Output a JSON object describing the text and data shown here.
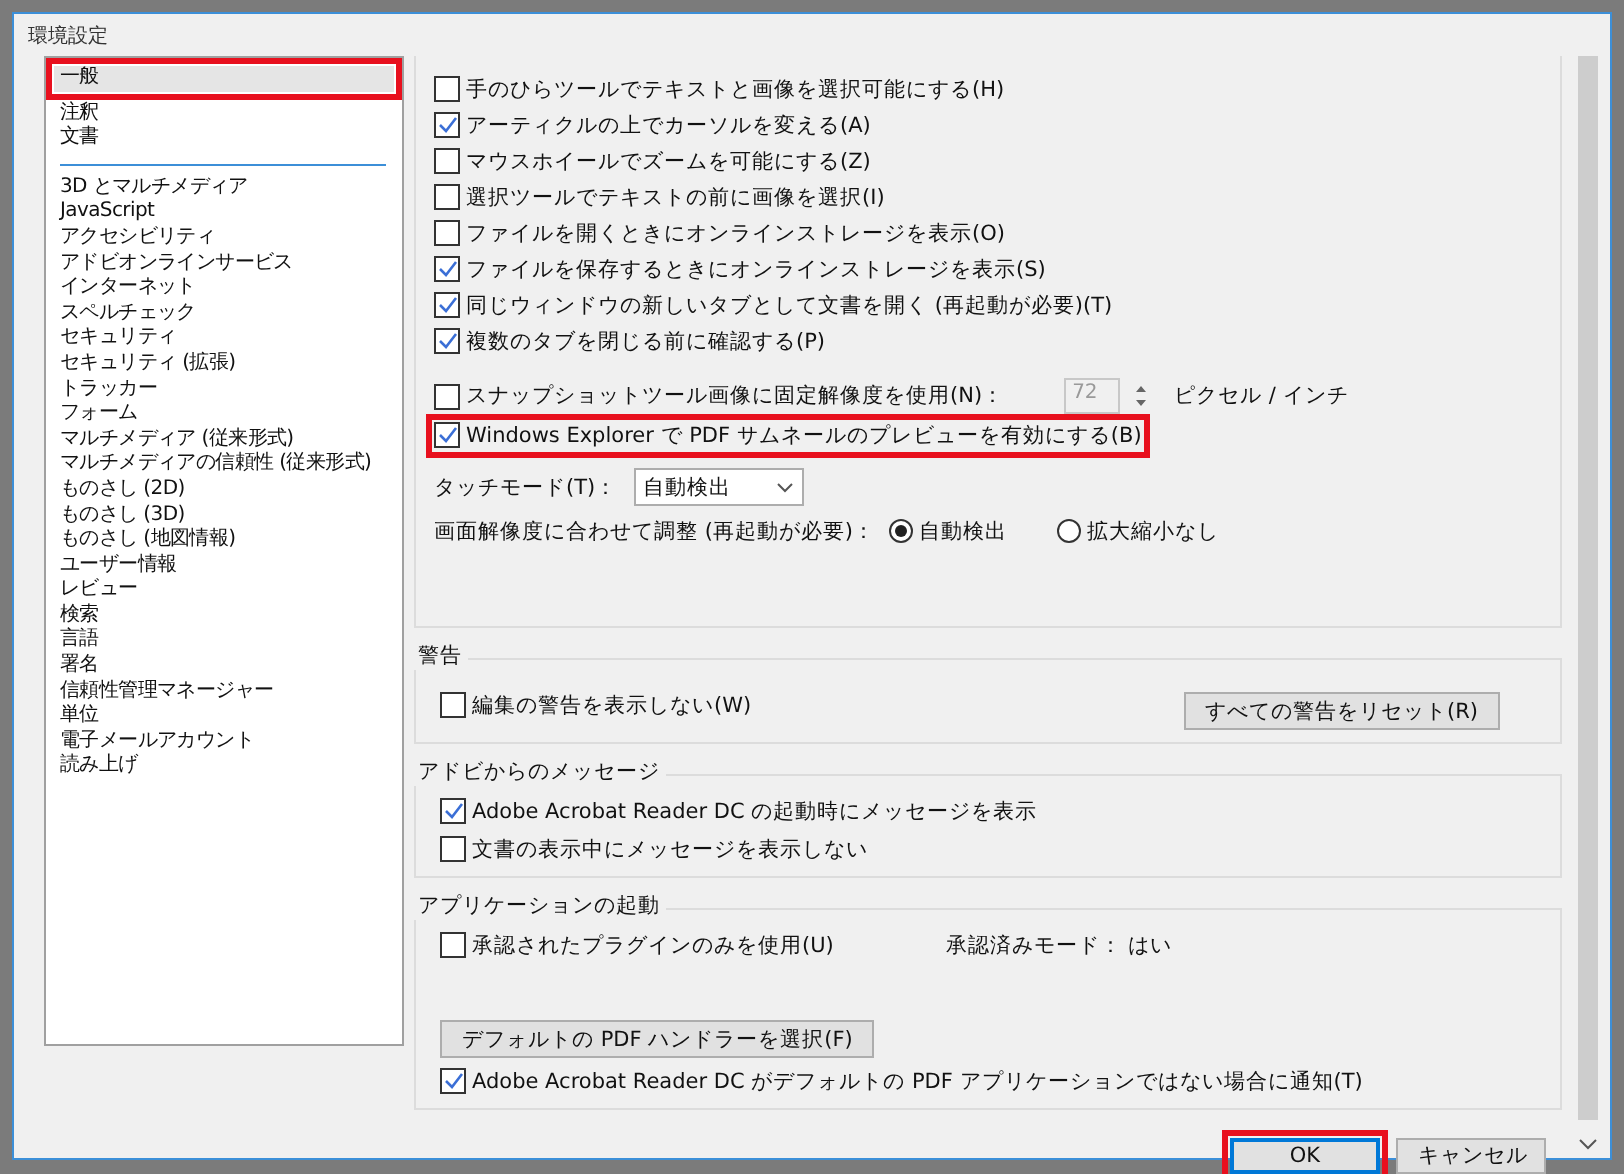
{
  "window": {
    "title": "環境設定"
  },
  "top_categories": [
    {
      "label": "一般",
      "selected": true,
      "highlighted": true
    },
    {
      "label": "注釈",
      "selected": false,
      "highlighted": false
    },
    {
      "label": "文書",
      "selected": false,
      "highlighted": false
    }
  ],
  "categories": [
    {
      "label": "3D とマルチメディア",
      "selected": false
    },
    {
      "label": "JavaScript",
      "selected": false
    },
    {
      "label": "アクセシビリティ",
      "selected": false
    },
    {
      "label": "アドビオンラインサービス",
      "selected": false
    },
    {
      "label": "インターネット",
      "selected": false
    },
    {
      "label": "スペルチェック",
      "selected": false
    },
    {
      "label": "セキュリティ",
      "selected": false
    },
    {
      "label": "セキュリティ (拡張)",
      "selected": false
    },
    {
      "label": "トラッカー",
      "selected": false
    },
    {
      "label": "フォーム",
      "selected": false
    },
    {
      "label": "マルチメディア (従来形式)",
      "selected": false
    },
    {
      "label": "マルチメディアの信頼性 (従来形式)",
      "selected": false
    },
    {
      "label": "ものさし (2D)",
      "selected": false
    },
    {
      "label": "ものさし (3D)",
      "selected": false
    },
    {
      "label": "ものさし (地図情報)",
      "selected": false
    },
    {
      "label": "ユーザー情報",
      "selected": false
    },
    {
      "label": "レビュー",
      "selected": false
    },
    {
      "label": "検索",
      "selected": false
    },
    {
      "label": "言語",
      "selected": false
    },
    {
      "label": "署名",
      "selected": false
    },
    {
      "label": "信頼性管理マネージャー",
      "selected": false
    },
    {
      "label": "単位",
      "selected": false
    },
    {
      "label": "電子メールアカウント",
      "selected": false
    },
    {
      "label": "読み上げ",
      "selected": false
    }
  ],
  "general_options": [
    {
      "kind": "checkbox",
      "label": "手のひらツールでテキストと画像を選択可能にする(H)",
      "checked": false,
      "highlighted": false
    },
    {
      "kind": "checkbox",
      "label": "アーティクルの上でカーソルを変える(A)",
      "checked": true,
      "highlighted": false
    },
    {
      "kind": "checkbox",
      "label": "マウスホイールでズームを可能にする(Z)",
      "checked": false,
      "highlighted": false
    },
    {
      "kind": "checkbox",
      "label": "選択ツールでテキストの前に画像を選択(I)",
      "checked": false,
      "highlighted": false
    },
    {
      "kind": "checkbox",
      "label": "ファイルを開くときにオンラインストレージを表示(O)",
      "checked": false,
      "highlighted": false
    },
    {
      "kind": "checkbox",
      "label": "ファイルを保存するときにオンラインストレージを表示(S)",
      "checked": true,
      "highlighted": false
    },
    {
      "kind": "checkbox",
      "label": "同じウィンドウの新しいタブとして文書を開く (再起動が必要)(T)",
      "checked": true,
      "highlighted": false
    },
    {
      "kind": "checkbox",
      "label": "複数のタブを閉じる前に確認する(P)",
      "checked": true,
      "highlighted": false
    },
    {
      "kind": "spin",
      "label": "スナップショットツール画像に固定解像度を使用(N)：",
      "checked": false,
      "value": "72",
      "unit": "ピクセル / インチ",
      "disabled": true
    },
    {
      "kind": "checkbox",
      "label": "Windows Explorer で PDF サムネールのプレビューを有効にする(B)",
      "checked": true,
      "highlighted": true
    },
    {
      "kind": "select",
      "label": "タッチモード(T)：",
      "value": "自動検出"
    },
    {
      "kind": "radio",
      "label": "画面解像度に合わせて調整 (再起動が必要)：",
      "choices": [
        {
          "label": "自動検出",
          "selected": true
        },
        {
          "label": "拡大縮小なし",
          "selected": false
        }
      ]
    }
  ],
  "sections": [
    {
      "title": "警告",
      "rows": [
        [
          {
            "kind": "checkbox",
            "label": "編集の警告を表示しない(W)",
            "checked": false
          },
          {
            "kind": "button",
            "label": "すべての警告をリセット(R)"
          }
        ]
      ]
    },
    {
      "title": "アドビからのメッセージ",
      "rows": [
        [
          {
            "kind": "checkbox",
            "label": "Adobe Acrobat Reader DC の起動時にメッセージを表示",
            "checked": true
          }
        ],
        [
          {
            "kind": "checkbox",
            "label": "文書の表示中にメッセージを表示しない",
            "checked": false
          }
        ]
      ]
    },
    {
      "title": "アプリケーションの起動",
      "rows": [
        [
          {
            "kind": "checkbox",
            "label": "承認されたプラグインのみを使用(U)",
            "checked": false
          },
          {
            "kind": "text",
            "label": "承認済みモード：  はい"
          }
        ],
        [
          {
            "kind": "button",
            "label": "デフォルトの PDF ハンドラーを選択(F)"
          }
        ],
        [
          {
            "kind": "checkbox",
            "label": "Adobe Acrobat Reader DC がデフォルトの PDF アプリケーションではない場合に通知(T)",
            "checked": true
          }
        ]
      ]
    }
  ],
  "buttons": [
    {
      "label": "OK",
      "default": true,
      "highlighted": true
    },
    {
      "label": "キャンセル",
      "default": false,
      "highlighted": false
    }
  ]
}
